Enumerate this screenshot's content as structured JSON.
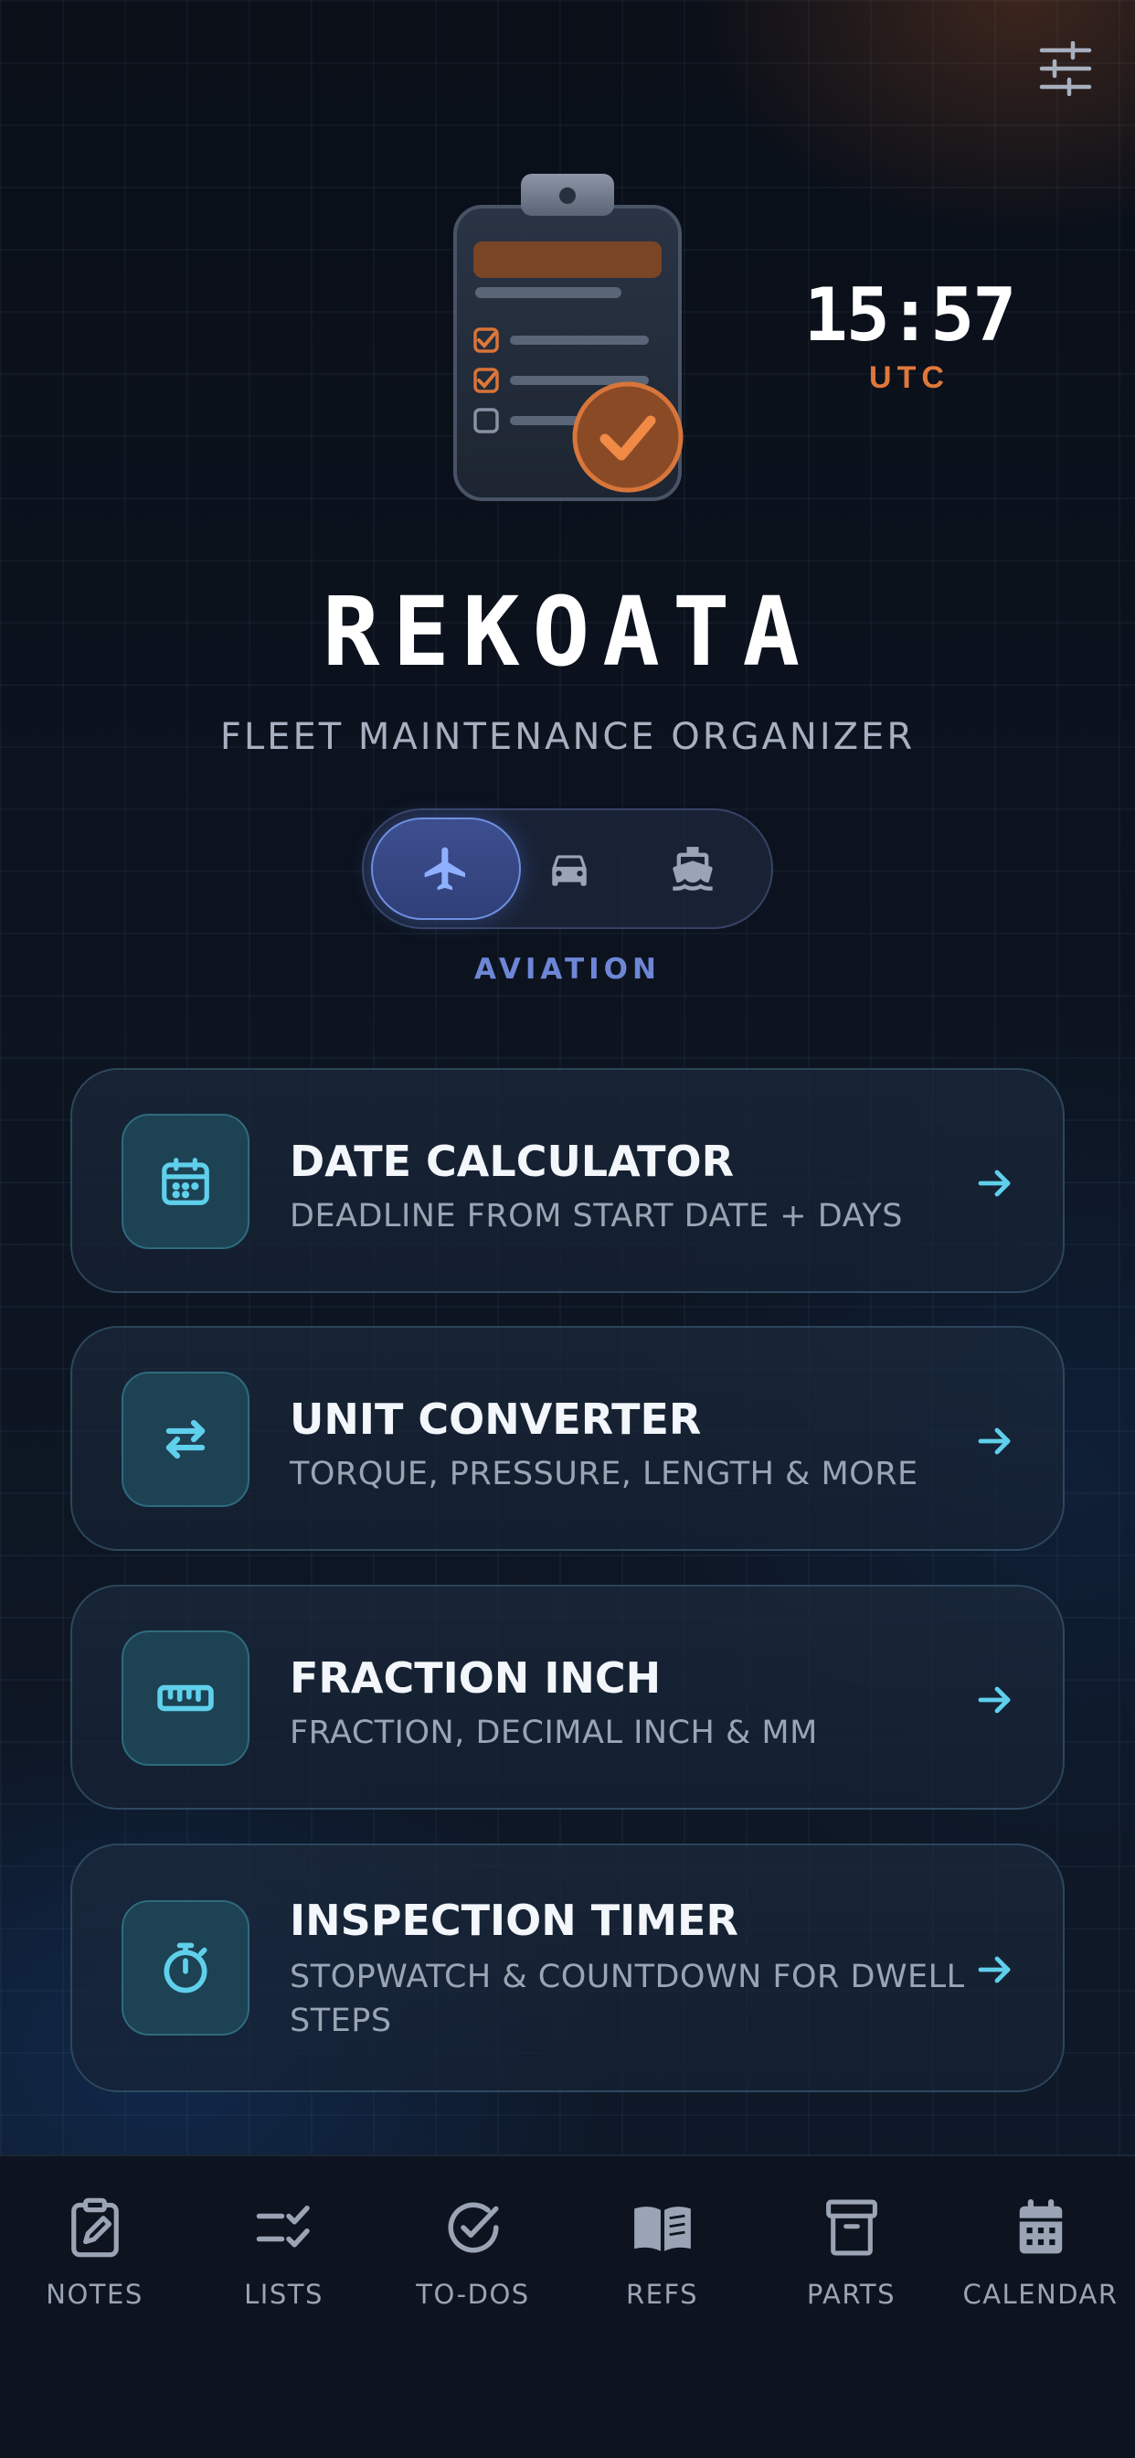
{
  "header": {
    "settings_icon": "sliders-icon",
    "clock": {
      "time": "15:57",
      "zone": "UTC"
    },
    "hero_icon": "clipboard-checklist-icon"
  },
  "app": {
    "title": "REKOATA",
    "subtitle": "FLEET MAINTENANCE ORGANIZER"
  },
  "mode_selector": {
    "selected_label": "AVIATION",
    "options": [
      {
        "name": "aviation",
        "icon": "airplane-icon",
        "active": true
      },
      {
        "name": "automotive",
        "icon": "car-icon",
        "active": false
      },
      {
        "name": "marine",
        "icon": "ship-icon",
        "active": false
      }
    ]
  },
  "tools": [
    {
      "title": "DATE CALCULATOR",
      "description": "DEADLINE FROM START DATE + DAYS",
      "icon": "calendar-icon"
    },
    {
      "title": "UNIT CONVERTER",
      "description": "TORQUE, PRESSURE, LENGTH & MORE",
      "icon": "swap-arrows-icon"
    },
    {
      "title": "FRACTION INCH",
      "description": "FRACTION, DECIMAL INCH & MM",
      "icon": "ruler-icon"
    },
    {
      "title": "INSPECTION TIMER",
      "description": "STOPWATCH & COUNTDOWN FOR DWELL STEPS",
      "icon": "stopwatch-icon"
    }
  ],
  "bottom_nav": [
    {
      "label": "NOTES",
      "icon": "notes-icon"
    },
    {
      "label": "LISTS",
      "icon": "checklist-icon"
    },
    {
      "label": "TO-DOS",
      "icon": "check-circle-icon"
    },
    {
      "label": "REFS",
      "icon": "book-icon"
    },
    {
      "label": "PARTS",
      "icon": "archive-box-icon"
    },
    {
      "label": "CALENDAR",
      "icon": "calendar-icon"
    }
  ],
  "colors": {
    "accent_orange": "#e0783a",
    "accent_blue": "#6e86d6",
    "accent_cyan": "#5fd0ec",
    "background": "#0b1019"
  }
}
